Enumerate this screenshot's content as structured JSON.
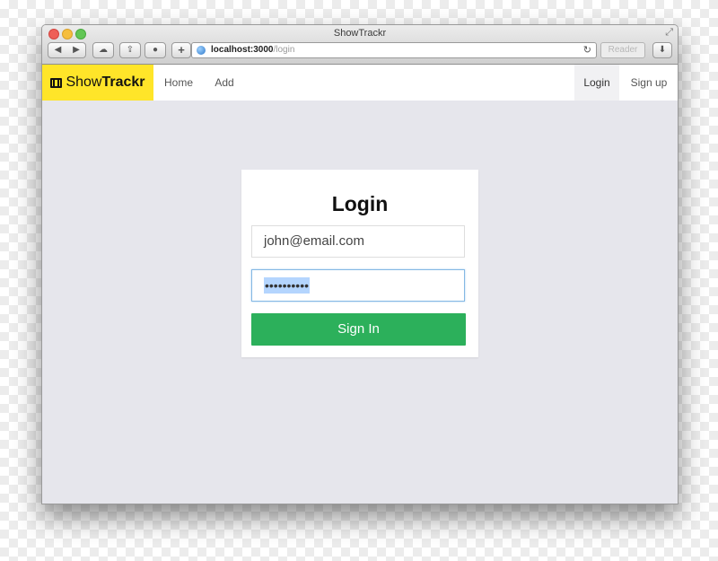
{
  "window": {
    "title": "ShowTrackr",
    "url_host": "localhost:3000",
    "url_path": "/login",
    "reader_label": "Reader"
  },
  "navbar": {
    "brand_light": "Show",
    "brand_bold": "Trackr",
    "brand_color": "#ffe529",
    "brand_icon": "film-icon",
    "links_left": [
      "Home",
      "Add"
    ],
    "links_right": [
      "Login",
      "Sign up"
    ],
    "active": "Login"
  },
  "login_form": {
    "title": "Login",
    "email_value": "john@email.com",
    "password_masked": "••••••••••",
    "submit_label": "Sign In",
    "submit_color": "#2cb05b"
  },
  "colors": {
    "page_background": "#e6e6ec",
    "focus_border": "#84b8e4"
  }
}
